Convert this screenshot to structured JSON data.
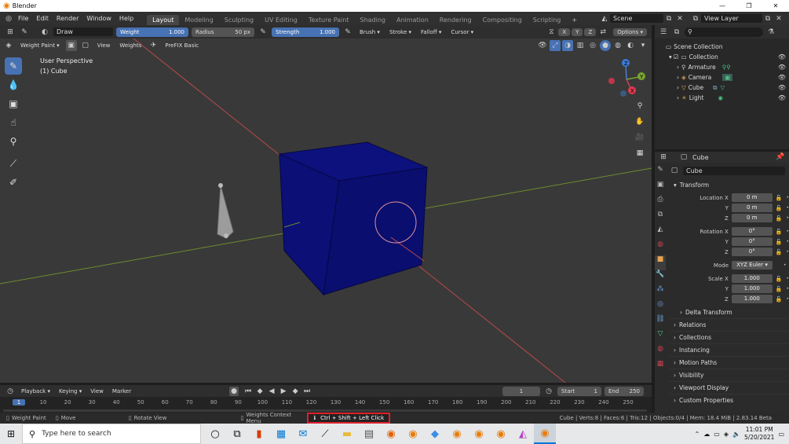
{
  "titlebar": {
    "title": "Blender",
    "minimize": "—",
    "maximize": "❐",
    "close": "✕"
  },
  "menu": [
    "File",
    "Edit",
    "Render",
    "Window",
    "Help"
  ],
  "workspaces": [
    "Layout",
    "Modeling",
    "Sculpting",
    "UV Editing",
    "Texture Paint",
    "Shading",
    "Animation",
    "Rendering",
    "Compositing",
    "Scripting"
  ],
  "active_workspace": "Layout",
  "scene": {
    "label": "Scene",
    "view_layer": "View Layer"
  },
  "toolheader": {
    "brush": "Draw",
    "weight_label": "Weight",
    "weight_value": "1.000",
    "radius_label": "Radius",
    "radius_value": "50 px",
    "strength_label": "Strength",
    "strength_value": "1.000",
    "menus": [
      "Brush",
      "Stroke",
      "Falloff",
      "Cursor"
    ],
    "sym": [
      "X",
      "Y",
      "Z"
    ],
    "options": "Options"
  },
  "viewport_header": {
    "mode": "Weight Paint",
    "view": "View",
    "weights": "Weights",
    "prefix": "PreFIX Basic"
  },
  "viewport": {
    "perspective": "User Perspective",
    "object": "(1) Cube"
  },
  "gizmo": {
    "x": "X",
    "y": "Y",
    "z": "Z"
  },
  "outliner": {
    "search_placeholder": "",
    "root": "Scene Collection",
    "collection": "Collection",
    "items": [
      "Armature",
      "Camera",
      "Cube",
      "Light"
    ]
  },
  "properties": {
    "object_name": "Cube",
    "data_name": "Cube",
    "transform": "Transform",
    "location": {
      "label": "Location X",
      "x": "0 m",
      "y": "0 m",
      "z": "0 m"
    },
    "rotation": {
      "label": "Rotation X",
      "x": "0°",
      "y": "0°",
      "z": "0°"
    },
    "mode_label": "Mode",
    "mode_value": "XYZ Euler",
    "scale": {
      "label": "Scale X",
      "x": "1.000",
      "y": "1.000",
      "z": "1.000"
    },
    "axis_y": "Y",
    "axis_z": "Z",
    "delta": "Delta Transform",
    "panels": [
      "Relations",
      "Collections",
      "Instancing",
      "Motion Paths",
      "Visibility",
      "Viewport Display",
      "Custom Properties"
    ]
  },
  "timeline": {
    "menus": [
      "Playback",
      "Keying",
      "View",
      "Marker"
    ],
    "current_frame": "1",
    "start_label": "Start",
    "start_value": "1",
    "end_label": "End",
    "end_value": "250",
    "ticks": [
      "1",
      "10",
      "20",
      "30",
      "40",
      "50",
      "60",
      "70",
      "80",
      "90",
      "100",
      "110",
      "120",
      "130",
      "140",
      "150",
      "160",
      "170",
      "180",
      "190",
      "200",
      "210",
      "220",
      "230",
      "240",
      "250"
    ]
  },
  "statusbar": {
    "left1": "Weight Paint",
    "left2": "Move",
    "left3": "Rotate View",
    "ctx": "Weights Context Menu",
    "shortcut": "Ctrl + Shift + Left Click",
    "stats": "Cube | Verts:8 | Faces:6 | Tris:12 | Objects:0/4 | Mem: 18.4 MiB | 2.83.14 Beta"
  },
  "taskbar": {
    "search_placeholder": "Type here to search",
    "time": "11:01 PM",
    "date": "5/20/2021"
  },
  "colors": {
    "accent": "#4772b3",
    "cube": "#0c0f78",
    "highlight": "#e0202a"
  }
}
